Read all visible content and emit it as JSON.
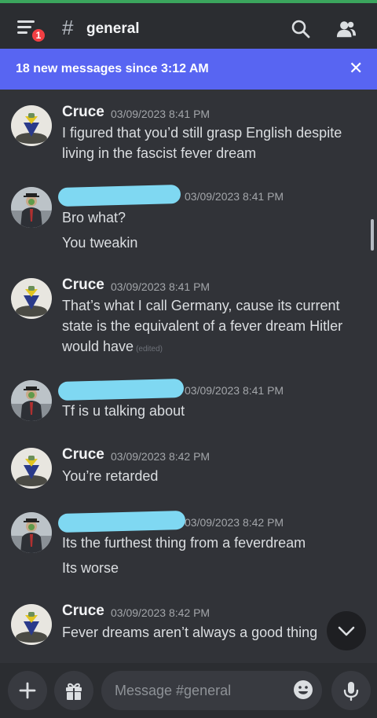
{
  "header": {
    "notification_count": "1",
    "hash_symbol": "#",
    "channel_name": "general"
  },
  "banner": {
    "text": "18 new messages since 3:12 AM",
    "close_glyph": "✕"
  },
  "messages": [
    {
      "author": "Cruce",
      "author_redacted": false,
      "timestamp": "03/09/2023 8:41 PM",
      "avatar": "hand-flag-avatar",
      "lines": [
        "I figured that you’d still grasp English despite",
        "living in the fascist fever dream"
      ]
    },
    {
      "author": "",
      "author_redacted": true,
      "timestamp": "03/09/2023 8:41 PM",
      "avatar": "man-in-suit-avatar",
      "lines": [
        "Bro what?",
        "You tweakin"
      ]
    },
    {
      "author": "Cruce",
      "author_redacted": false,
      "timestamp": "03/09/2023 8:41 PM",
      "avatar": "hand-flag-avatar",
      "lines": [
        "That’s what I call Germany, cause its current",
        "state is the equivalent of a fever dream Hitler",
        "would have"
      ],
      "edited_label": "(edited)"
    },
    {
      "author": "",
      "author_redacted": true,
      "timestamp": "03/09/2023 8:41 PM",
      "avatar": "man-in-suit-avatar",
      "lines": [
        "Tf is u talking about"
      ]
    },
    {
      "author": "Cruce",
      "author_redacted": false,
      "timestamp": "03/09/2023 8:42 PM",
      "avatar": "hand-flag-avatar",
      "lines": [
        "You’re retarded"
      ]
    },
    {
      "author": "",
      "author_redacted": true,
      "timestamp": "03/09/2023 8:42 PM",
      "avatar": "man-in-suit-avatar",
      "lines": [
        "Its the furthest thing from a feverdream",
        "Its worse"
      ]
    },
    {
      "author": "Cruce",
      "author_redacted": false,
      "timestamp": "03/09/2023 8:42 PM",
      "avatar": "hand-flag-avatar",
      "lines": [
        "Fever dreams aren’t always a good thing"
      ]
    }
  ],
  "composer": {
    "placeholder": "Message #general"
  },
  "colors": {
    "background": "#313338",
    "header": "#2b2d31",
    "accent_banner": "#5865f2",
    "badge": "#f23f43",
    "redaction": "#7fd8f2"
  },
  "icons": [
    "menu-icon",
    "search-icon",
    "members-icon",
    "close-icon",
    "chevron-down-icon",
    "plus-icon",
    "gift-icon",
    "emoji-icon",
    "mic-icon"
  ]
}
